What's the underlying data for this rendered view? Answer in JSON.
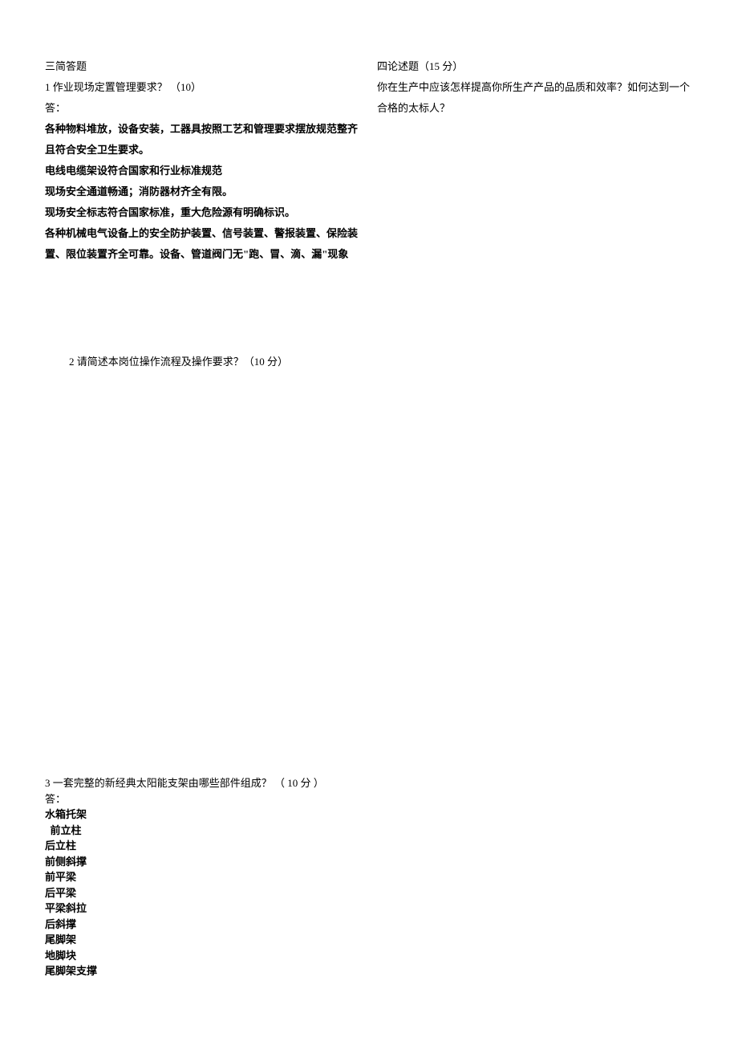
{
  "left": {
    "title": "三简答题",
    "q1_heading": "1 作业现场定置管理要求？ （10）",
    "answer_label": "答：",
    "a1_p1": "各种物料堆放，设备安装，工器具按照工艺和管理要求摆放规范整齐且符合安全卫生要求。",
    "a1_p2": "电线电缆架设符合国家和行业标准规范",
    "a1_p3": "现场安全通道畅通；消防器材齐全有限。",
    "a1_p4": "现场安全标志符合国家标准，重大危险源有明确标识。",
    "a1_p5": "各种机械电气设备上的安全防护装置、信号装置、警报装置、保险装置、限位装置齐全可靠。设备、管道阀门无\"跑、冒、滴、漏\"现象"
  },
  "q2": {
    "heading": "2 请简述本岗位操作流程及操作要求？（10 分）"
  },
  "q3": {
    "heading": "3 一套完整的新经典太阳能支架由哪些部件组成？ （ 10 分 ）",
    "answer_label": "答：",
    "items": {
      "i1": "水箱托架",
      "i2": "  前立柱",
      "i3": "后立柱",
      "i4": "前侧斜撑",
      "i5": "前平梁",
      "i6": "后平梁",
      "i7": "平梁斜拉",
      "i8": "后斜撑",
      "i9": "尾脚架",
      "i10": "地脚块",
      "i11": "尾脚架支撑"
    }
  },
  "right": {
    "title": "四论述题（15 分）",
    "body": "你在生产中应该怎样提高你所生产产品的品质和效率？如何达到一个合格的太标人？"
  }
}
